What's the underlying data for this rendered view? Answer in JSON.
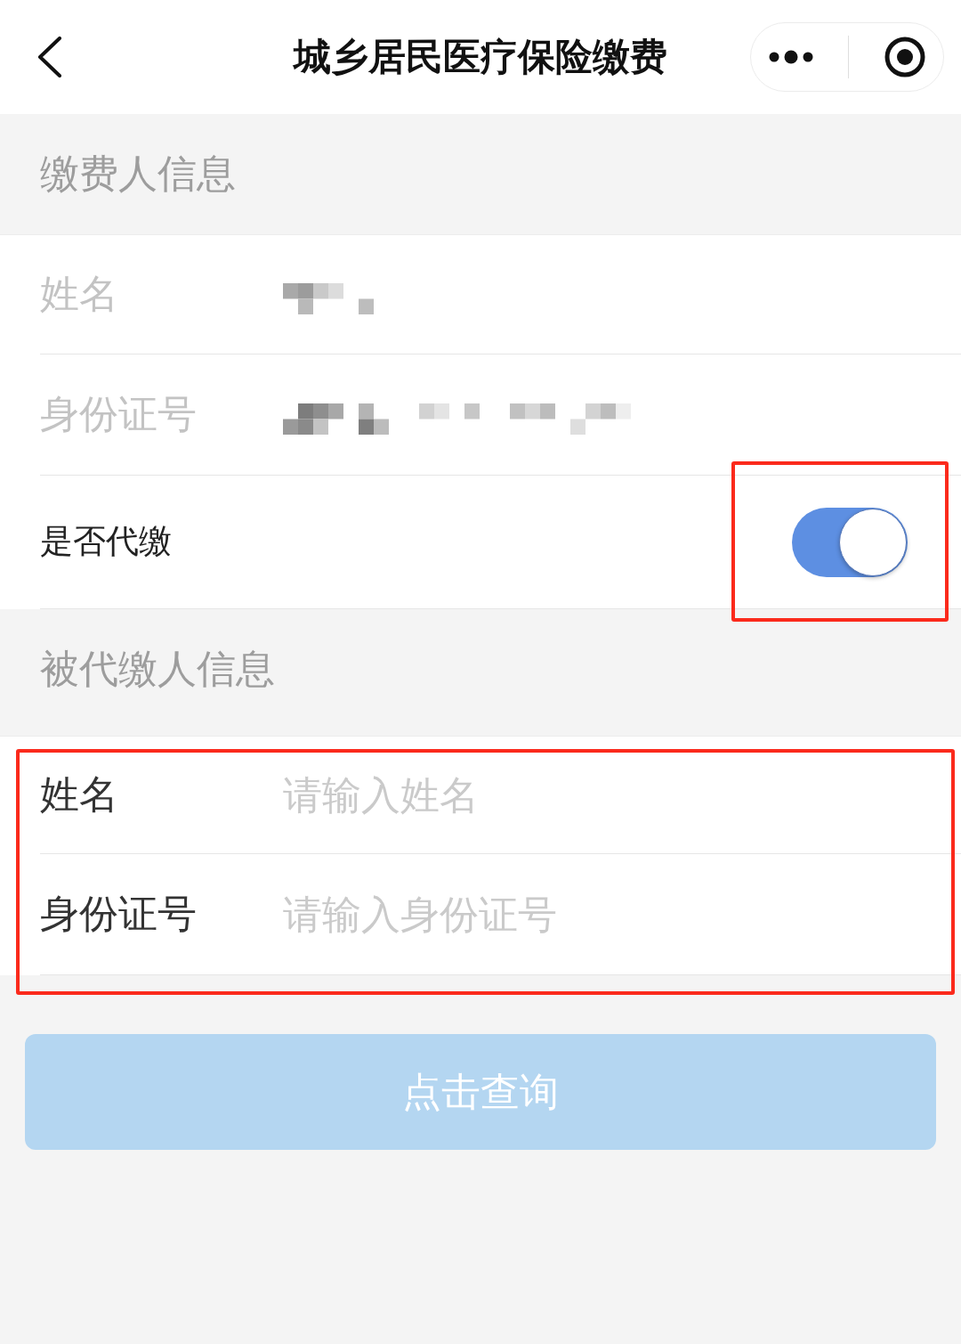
{
  "nav": {
    "title": "城乡居民医疗保险缴费"
  },
  "sections": [
    {
      "heading": "缴费人信息",
      "rows": [
        {
          "kind": "field",
          "label": "姓名",
          "disabled": true,
          "redacted": true
        },
        {
          "kind": "field",
          "label": "身份证号",
          "disabled": true,
          "redacted": true
        },
        {
          "kind": "switch",
          "label": "是否代缴",
          "on": true,
          "highlighted": true
        }
      ]
    },
    {
      "heading": "被代缴人信息",
      "highlighted": true,
      "rows": [
        {
          "kind": "field",
          "label": "姓名",
          "placeholder": "请输入姓名",
          "disabled": false
        },
        {
          "kind": "field",
          "label": "身份证号",
          "placeholder": "请输入身份证号",
          "disabled": false
        }
      ]
    }
  ],
  "submit": {
    "label": "点击查询",
    "disabled": true
  }
}
